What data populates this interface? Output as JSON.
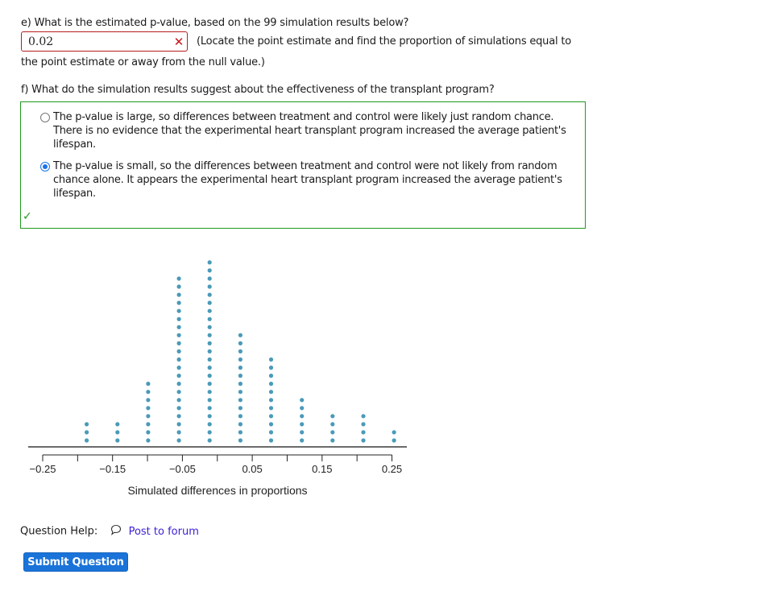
{
  "question_e": {
    "label": "e) What is the estimated p-value, based on the 99 simulation results below?",
    "answer_value": "0.02",
    "status_icon": "wrong-x-icon",
    "hint_line1": "(Locate the point estimate and find the proportion of simulations equal to",
    "hint_line2": "the point estimate or away from the null value.)"
  },
  "question_f": {
    "label": "f) What do the simulation results suggest about the effectiveness of the transplant program?",
    "choices": [
      {
        "text": "The p-value is large, so differences between treatment and control were likely just random chance. There is no evidence that the experimental heart transplant program increased the average patient's lifespan.",
        "selected": false
      },
      {
        "text": "The p-value is small, so the differences between treatment and control were not likely from random chance alone. It appears the experimental heart transplant program increased the average patient's lifespan.",
        "selected": true
      }
    ],
    "status_icon": "correct-check-icon",
    "status_symbol": "✓",
    "wrong_symbol": "✕"
  },
  "chart_data": {
    "type": "scatter",
    "subtype": "dot-plot",
    "title": "",
    "xlabel": "Simulated differences in proportions",
    "ylabel": "",
    "xlim": [
      -0.25,
      0.26
    ],
    "major_ticks": [
      -0.25,
      -0.15,
      -0.05,
      0.05,
      0.15,
      0.25
    ],
    "tick_labels": [
      "−0.25",
      "−0.15",
      "−0.05",
      "0.05",
      "0.15",
      "0.25"
    ],
    "minor_ticks": [
      -0.2,
      -0.1,
      0.0,
      0.1,
      0.2
    ],
    "x": [
      -0.187,
      -0.143,
      -0.099,
      -0.055,
      -0.011,
      0.033,
      0.077,
      0.121,
      0.165,
      0.209,
      0.253
    ],
    "counts": [
      3,
      3,
      8,
      21,
      23,
      14,
      11,
      6,
      4,
      4,
      2
    ],
    "total": 99,
    "dot_color": "#4a9ab8",
    "grid": false
  },
  "help": {
    "label": "Question Help:",
    "forum_icon": "speech-bubble-icon",
    "forum_label": "Post to forum"
  },
  "submit": {
    "label": "Submit Question"
  },
  "colors": {
    "wrong": "#c8161d",
    "correct": "#1e9a1e",
    "link": "#3b1fd6",
    "primary_button": "#1a73d9"
  }
}
